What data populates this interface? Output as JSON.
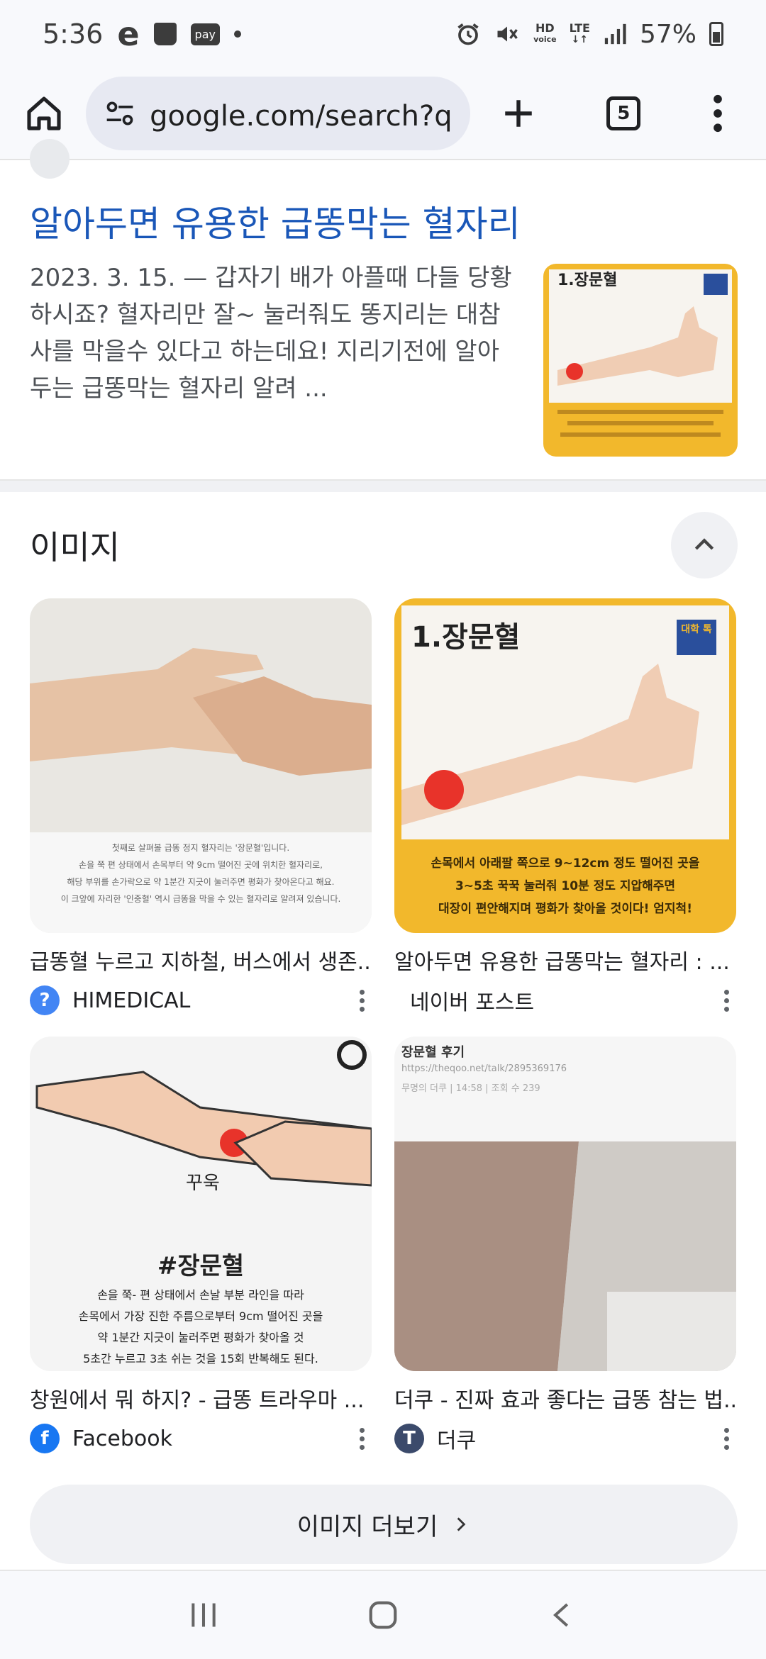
{
  "status_bar": {
    "time": "5:36",
    "e_label": "e",
    "pay_label": "pay",
    "hd_label": "HD",
    "voice_label": "voice",
    "lte_label": "LTE",
    "battery": "57%"
  },
  "toolbar": {
    "url": "google.com/search?q=똥",
    "tab_count": "5"
  },
  "result": {
    "title": "알아두면 유용한 급똥막는 혈자리",
    "snippet": "2023. 3. 15. — 갑자기 배가 아플때 다들 당황하시죠? 혈자리만 잘~ 눌러줘도 똥지리는 대참사를 막을수 있다고 하는데요! 지리기전에 알아두는 급똥막는 혈자리 알려 ..."
  },
  "images": {
    "heading": "이미지",
    "tiles": [
      {
        "caption": "급똥혈 누르고 지하철, 버스에서 생존...",
        "source": "HIMEDICAL",
        "icon": "question-icon",
        "color": "#4285f4"
      },
      {
        "caption": "알아두면 유용한 급똥막는 혈자리 : ...",
        "source": "네이버 포스트",
        "icon": "none",
        "color": "#ffffff"
      },
      {
        "caption": "창원에서 뭐 하지? - 급똥 트라우마 ...",
        "source": "Facebook",
        "icon": "facebook-icon",
        "color": "#1877f2"
      },
      {
        "caption": "더쿠 - 진짜 효과 좋다는 급똥 참는 법...",
        "source": "더쿠",
        "icon": "T",
        "color": "#3b4a6b"
      }
    ],
    "tile1_overlay": {
      "line1": "첫째로 살펴볼 급똥 정지 혈자리는 '장문혈'입니다.",
      "line2": "손을 쭉 편 상태에서 손목부터 약 9cm 떨어진 곳에 위치한 혈자리로,",
      "line3": "해당 부위를 손가락으로 약 1분간 지긋이 눌러주면 평화가 찾아온다고 해요.",
      "line4": "이 크앞에 자리한 '인중혈' 역시 급똥을 막을 수 있는 혈자리로 알려져 있습니다."
    },
    "tile2_overlay": {
      "title": "1.장문혈",
      "badge": "대학 톡",
      "line1": "손목에서 아래팔 쪽으로 9~12cm 정도 떨어진 곳을",
      "line2": "3~5초 꾹꾹 눌러줘 10분 정도 지압해주면",
      "line3": "대장이 편안해지며 평화가 찾아올 것이다! 엄지척!"
    },
    "tile3_overlay": {
      "sound": "꾸욱",
      "title": "#장문혈",
      "line1": "손을 쭉- 편 상태에서 손날 부분 라인을 따라",
      "line2": "손목에서 가장 진한 주름으로부터 9cm 떨어진 곳을",
      "line3": "약 1분간 지긋이 눌러주면 평화가 찾아올 것",
      "line4": "5초간 누르고 3초 쉬는 것을 15회 반복해도 된다."
    },
    "tile4_overlay": {
      "title": "장문혈 후기",
      "url": "https://theqoo.net/talk/2895369176",
      "meta": "무명의 더쿠 | 14:58 | 조회 수 239"
    },
    "more_label": "이미지 더보기"
  }
}
